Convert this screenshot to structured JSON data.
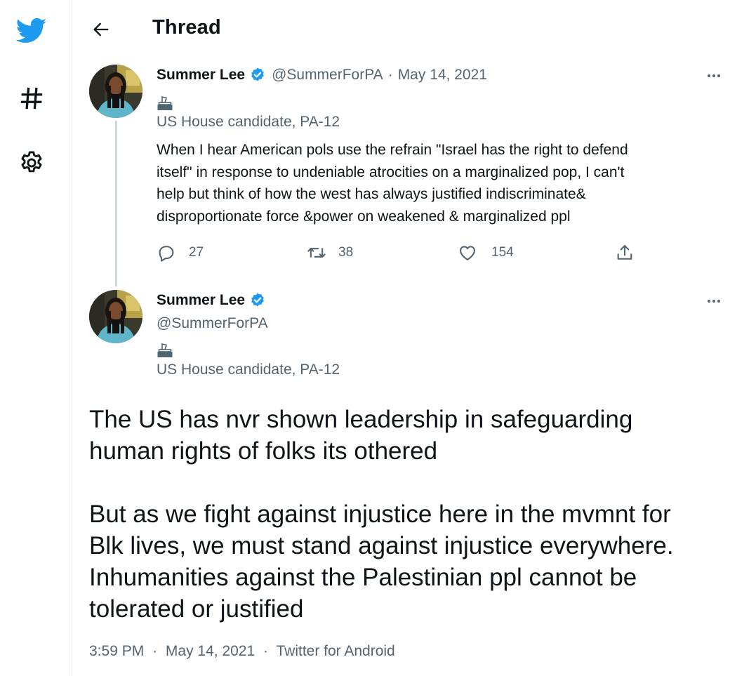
{
  "nav": {
    "icons": [
      "twitter-logo",
      "hashtag-icon",
      "gear-icon"
    ]
  },
  "header": {
    "title": "Thread"
  },
  "tweet1": {
    "name": "Summer Lee",
    "handle": "@SummerForPA",
    "separator": "·",
    "date": "May 14, 2021",
    "bio_icon": "ballot-box-icon",
    "bio": "US House candidate, PA-12",
    "text_lines": [
      "When I hear American pols use the refrain \"Israel has the right to defend",
      "itself\" in response to undeniable atrocities on a marginalized pop, I can't",
      "help but think of how the west has always justified indiscriminate&",
      "disproportionate force &power on weakened & marginalized ppl"
    ],
    "actions": {
      "replies": "27",
      "retweets": "38",
      "likes": "154"
    }
  },
  "tweet2": {
    "name": "Summer Lee",
    "handle": "@SummerForPA",
    "bio_icon": "ballot-box-icon",
    "bio": "US House candidate, PA-12",
    "paragraph1": [
      "The US has nvr shown leadership in safeguarding",
      "human rights of folks its othered"
    ],
    "paragraph2": [
      "But as we fight against injustice here in the mvmnt for",
      "Blk lives, we must stand against injustice everywhere.",
      "Inhumanities against the Palestinian ppl cannot be",
      "tolerated or justified"
    ],
    "footer": {
      "time": "3:59 PM",
      "date": "May 14, 2021",
      "source": "Twitter for Android",
      "separator": "·"
    }
  },
  "colors": {
    "brand": "#1d9bf0",
    "text": "#0f1419",
    "secondary": "#536471",
    "thread_line": "#cfd9de"
  }
}
